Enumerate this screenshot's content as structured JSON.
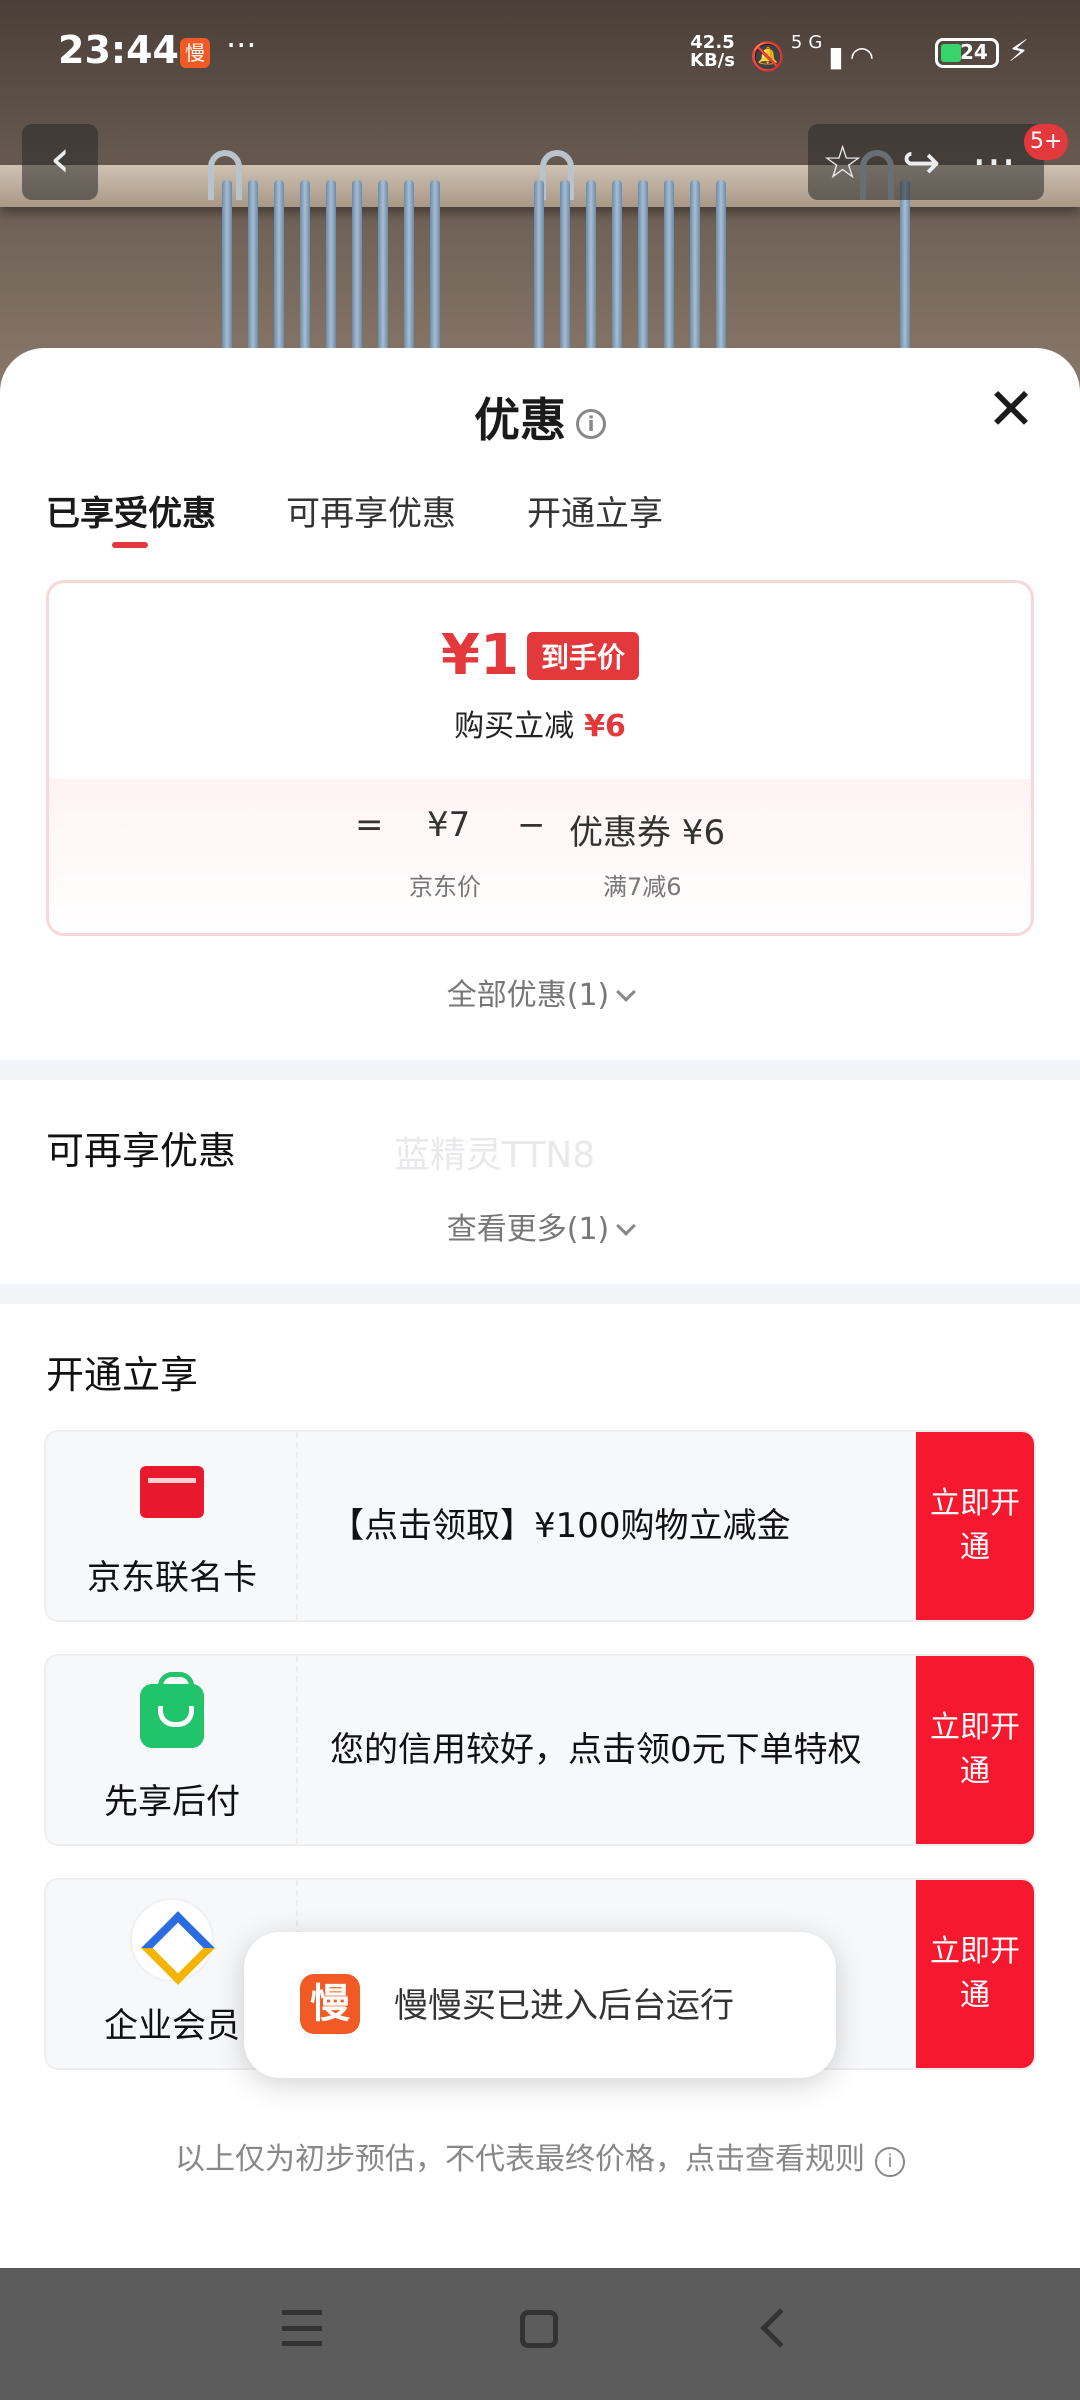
{
  "status_bar": {
    "time": "23:44",
    "app_icon_text": "慢",
    "more": "···",
    "net_speed": "42.5",
    "net_unit": "KB/s",
    "signal": "5G",
    "battery": "24",
    "icons": [
      "mute-icon",
      "signal-icon",
      "wifi-icon",
      "battery-icon",
      "charging-icon"
    ]
  },
  "header": {
    "back_icon": "chevron-left-icon",
    "back_glyph": "‹",
    "actions": [
      "star-icon",
      "share-icon",
      "more-icon"
    ],
    "action_glyphs": [
      "☆",
      "↪",
      "···"
    ],
    "badge": "5+"
  },
  "sheet": {
    "title": "优惠",
    "info_glyph": "i",
    "close_glyph": "✕",
    "tabs": [
      "已享受优惠",
      "可再享优惠",
      "开通立享"
    ],
    "active_tab": 0
  },
  "price_card": {
    "final_price": "¥1",
    "final_tag": "到手价",
    "reduce_label": "购买立减",
    "reduce_amount": "¥6",
    "equals": "=",
    "base_price": "¥7",
    "minus": "−",
    "coupon": "优惠券 ¥6",
    "base_label": "京东价",
    "coupon_rule": "满7减6"
  },
  "all_offers_link": "全部优惠(1)",
  "more_section": {
    "title": "可再享优惠",
    "watermark": "蓝精灵TTN8",
    "link": "查看更多(1)"
  },
  "open_section": {
    "title": "开通立享",
    "offers": [
      {
        "icon": "card-icon",
        "name": "京东联名卡",
        "desc": "【点击领取】¥100购物立减金",
        "cta": "立即开通"
      },
      {
        "icon": "shopping-bag-icon",
        "name": "先享后付",
        "desc": "您的信用较好，点击领0元下单特权",
        "cta": "立即开通"
      },
      {
        "icon": "diamond-icon",
        "name": "企业会员",
        "desc": "",
        "cta": "立即开通"
      }
    ]
  },
  "toast": {
    "app_icon_text": "慢",
    "message": "慢慢买已进入后台运行"
  },
  "disclaimer": "以上仅为初步预估，不代表最终价格，点击查看规则",
  "colors": {
    "accent_red": "#e4393c",
    "cta_red": "#f5182e",
    "card_pink_border": "#f9d7d9",
    "section_gray": "#f3f4f8"
  }
}
